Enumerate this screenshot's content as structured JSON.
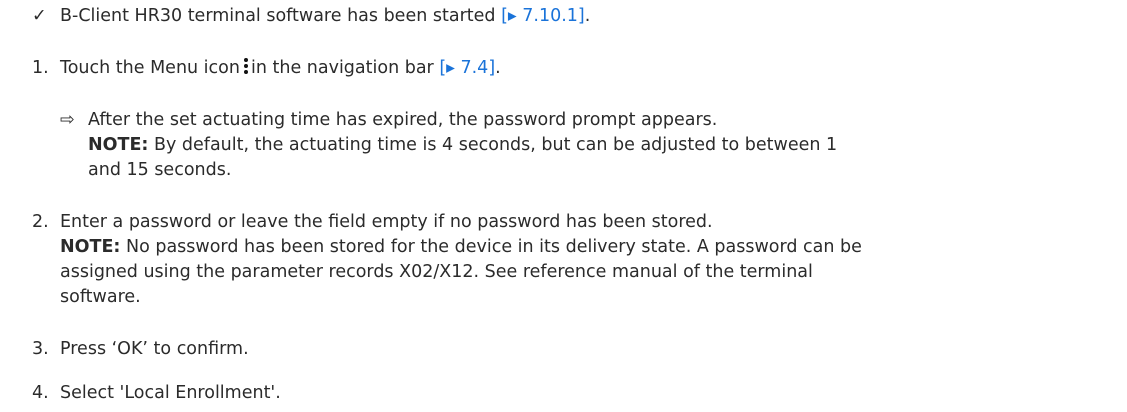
{
  "prerequisite": {
    "marker": "✓",
    "text": "B-Client HR30 terminal software has been started ",
    "ref": "[▸ 7.10.1]",
    "end": "."
  },
  "steps": [
    {
      "number": "1.",
      "text_before": "Touch the Menu icon",
      "text_after": "in the navigation bar ",
      "ref": "[▸ 7.4]",
      "end": ".",
      "icon": "menu-icon",
      "result": {
        "marker": "⇨",
        "text": "After the set actuating time has expired, the password prompt appears.",
        "note_label": "NOTE:",
        "note_line1": " By default, the actuating time is 4 seconds, but can be adjusted to between 1",
        "note_line2": "and 15 seconds."
      }
    },
    {
      "number": "2.",
      "text": "Enter a password or leave the field empty if no password has been stored.",
      "note_label": "NOTE:",
      "note_line1": " No password has been stored for the device in its delivery state. A password can be",
      "note_line2": "assigned using the parameter records X02/X12. See reference manual of the terminal",
      "note_line3": "software."
    },
    {
      "number": "3.",
      "text": "Press ‘OK’ to confirm."
    },
    {
      "number": "4.",
      "text": "Select 'Local Enrollment'."
    }
  ],
  "colors": {
    "text": "#2b2b2b",
    "link": "#1a73d9"
  }
}
